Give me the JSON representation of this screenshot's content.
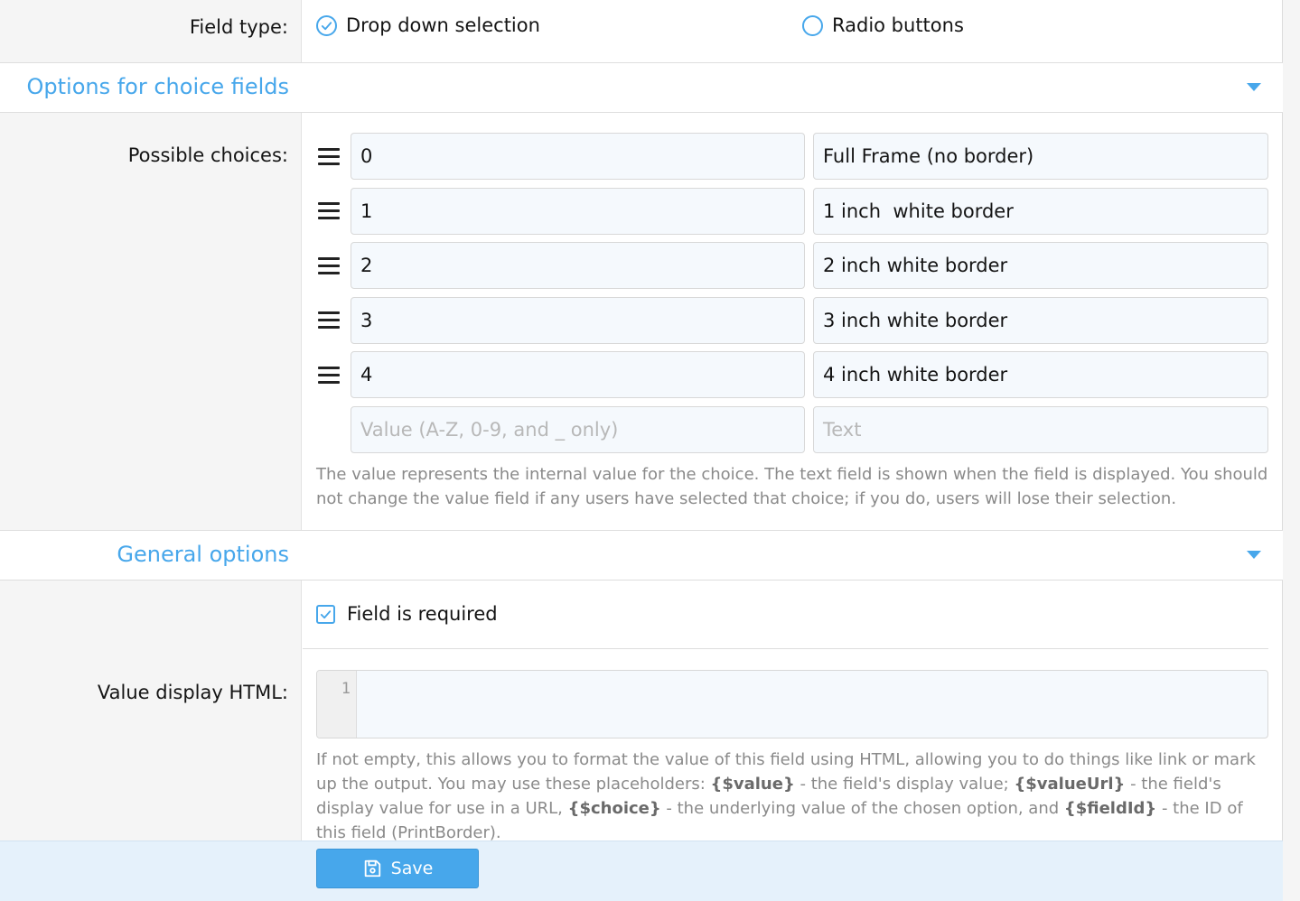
{
  "field_type": {
    "label": "Field type:",
    "options": [
      {
        "label": "Drop down selection",
        "selected": true
      },
      {
        "label": "Radio buttons",
        "selected": false
      }
    ]
  },
  "choice_section": {
    "title": "Options for choice fields",
    "possible_choices_label": "Possible choices:",
    "choices": [
      {
        "value": "0",
        "text": "Full Frame (no border)"
      },
      {
        "value": "1",
        "text": "1 inch  white border"
      },
      {
        "value": "2",
        "text": "2 inch white border"
      },
      {
        "value": "3",
        "text": "3 inch white border"
      },
      {
        "value": "4",
        "text": "4 inch white border"
      }
    ],
    "new_value_placeholder": "Value (A-Z, 0-9, and _ only)",
    "new_text_placeholder": "Text",
    "hint": "The value represents the internal value for the choice. The text field is shown when the field is displayed. You should not change the value field if any users have selected that choice; if you do, users will lose their selection."
  },
  "general_section": {
    "title": "General options",
    "required_label": "Field is required",
    "required_checked": true,
    "value_display_label": "Value display HTML:",
    "editor_line": "1",
    "hint_parts": {
      "p1": "If not empty, this allows you to format the value of this field using HTML, allowing you to do things like link or mark up the output. You may use these placeholders: ",
      "ph_value": "{$value}",
      "p2": " - the field's display value; ",
      "ph_valueurl": "{$valueUrl}",
      "p3": " - the field's display value for use in a URL, ",
      "ph_choice": "{$choice}",
      "p4": " - the underlying value of the chosen option, and ",
      "ph_fieldid": "{$fieldId}",
      "p5": " - the ID of this field (PrintBorder)."
    }
  },
  "footer": {
    "save_label": "Save"
  },
  "icons": {
    "radio_checked": "check-circle-icon",
    "drag": "drag-handle-icon",
    "caret": "caret-down-icon",
    "checkbox": "checkbox-check-icon",
    "save": "floppy-disk-icon"
  },
  "colors": {
    "accent": "#47a7eb",
    "label_bg": "#f5f5f5",
    "input_bg": "#f5f9fd",
    "footer_bg": "#e5f1fb"
  }
}
